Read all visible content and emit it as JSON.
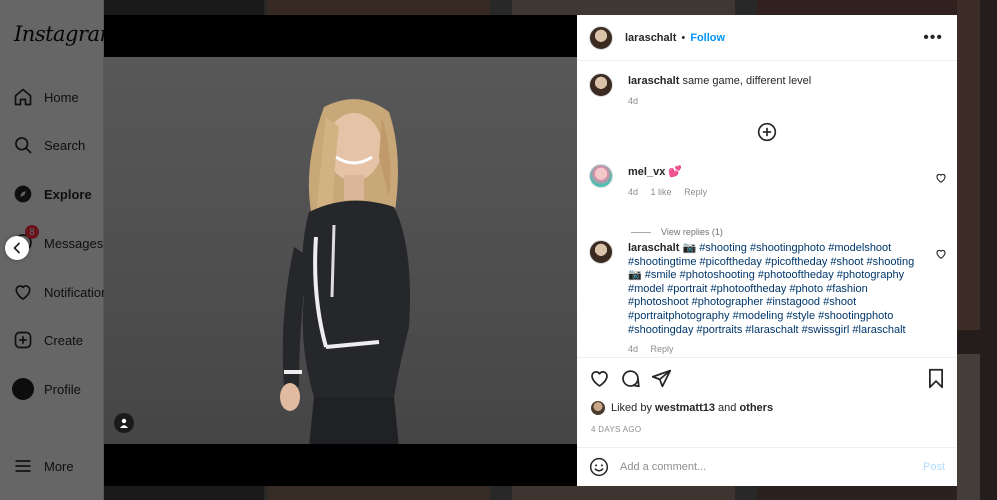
{
  "app": {
    "logo": "Instagram"
  },
  "sidebar": {
    "items": [
      {
        "label": "Home",
        "icon": "home-icon"
      },
      {
        "label": "Search",
        "icon": "search-icon"
      },
      {
        "label": "Explore",
        "icon": "compass-icon",
        "active": true
      },
      {
        "label": "Messages",
        "icon": "messenger-icon",
        "badge": "8"
      },
      {
        "label": "Notifications",
        "icon": "heart-icon"
      },
      {
        "label": "Create",
        "icon": "plus-square-icon"
      },
      {
        "label": "Profile",
        "icon": "avatar-icon"
      },
      {
        "label": "More",
        "icon": "hamburger-icon"
      }
    ]
  },
  "post": {
    "author": "laraschalt",
    "follow_label": "Follow",
    "caption": {
      "user": "laraschalt",
      "text": "same game, different level",
      "time": "4d"
    },
    "comments": [
      {
        "user": "mel_vx",
        "text": "💕",
        "time": "4d",
        "likes": "1 like",
        "reply_label": "Reply",
        "view_replies": "View replies (1)"
      },
      {
        "user": "laraschalt",
        "text": "📷 #shooting #shootingphoto #modelshoot #shootingtime #picoftheday #picoftheday #shoot #shooting 📷 #smile #photoshooting #photooftheday #photography #model #portrait #photooftheday #photo #fashion #photoshoot #photographer #instagood #shoot #portraitphotography #modeling #style #shootingphoto #shootingday #portraits #laraschalt #swissgirl #laraschalt",
        "time": "4d",
        "reply_label": "Reply"
      }
    ],
    "liked_by_prefix": "Liked by",
    "liked_by_user": "westmatt13",
    "liked_by_and": "and",
    "liked_by_others": "others",
    "time_ago": "4 DAYS AGO",
    "add_comment_placeholder": "Add a comment...",
    "post_label": "Post"
  },
  "colors": {
    "accent": "#0095f6",
    "post_disabled": "#b3dbff",
    "badge": "#ff3040"
  }
}
